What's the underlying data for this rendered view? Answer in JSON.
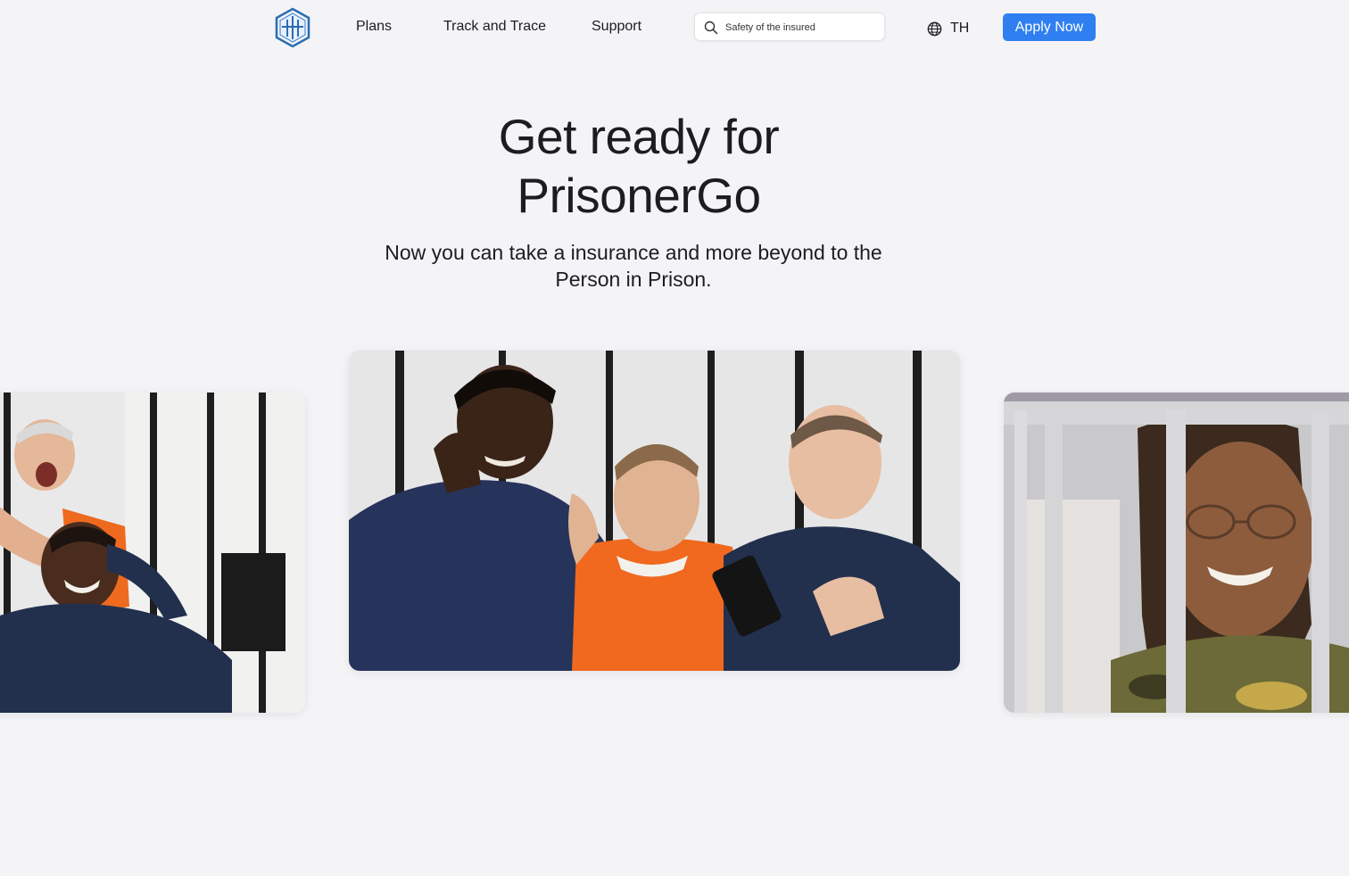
{
  "nav": {
    "logo_icon": "hexagon-shield-logo",
    "links": [
      {
        "label": "Plans"
      },
      {
        "label": "Track and Trace"
      },
      {
        "label": "Support"
      }
    ],
    "search": {
      "icon": "search-icon",
      "placeholder": "Safety of the insured"
    },
    "language": {
      "icon": "globe-icon",
      "label": "TH"
    },
    "apply_label": "Apply Now"
  },
  "hero": {
    "title_line1": "Get ready for",
    "title_line2": "PrisonerGo",
    "subtitle_line1": "Now you can take a insurance and more beyond to the",
    "subtitle_line2": "Person in Prison."
  },
  "carousel": {
    "images": [
      {
        "name": "two-inmates-behind-bars-photo"
      },
      {
        "name": "three-inmates-selfie-photo"
      },
      {
        "name": "smiling-woman-behind-bars-photo"
      }
    ]
  },
  "colors": {
    "accent": "#2f7ff1",
    "background": "#f4f4f6",
    "text": "#1d1d1f"
  }
}
